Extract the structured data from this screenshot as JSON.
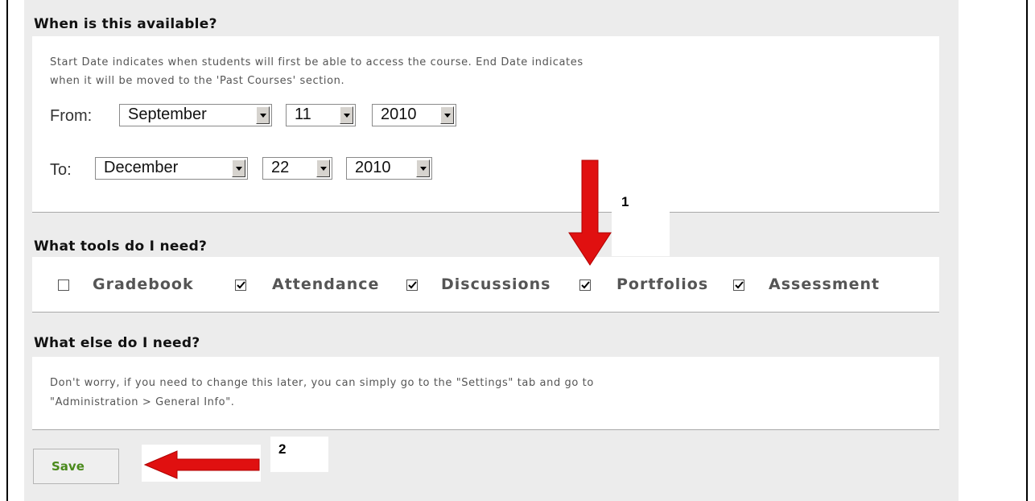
{
  "availability": {
    "heading": "When is this available?",
    "desc_line1": "Start Date indicates when students will first be able to access the course. End Date indicates",
    "desc_line2": "when it will be moved to the 'Past Courses' section.",
    "from_label": "From:",
    "from_month": "September",
    "from_day": "11",
    "from_year": "2010",
    "to_label": "To:",
    "to_month": "December",
    "to_day": "22",
    "to_year": "2010"
  },
  "tools": {
    "heading": "What tools do I need?",
    "items": [
      {
        "label": "Gradebook",
        "checked": false
      },
      {
        "label": "Attendance",
        "checked": true
      },
      {
        "label": "Discussions",
        "checked": true
      },
      {
        "label": "Portfolios",
        "checked": true
      },
      {
        "label": "Assessment",
        "checked": true
      }
    ]
  },
  "else": {
    "heading": "What else do I need?",
    "desc_line1": "Don't worry, if you need to change this later, you can simply go to the \"Settings\" tab and go to",
    "desc_line2": "\"Administration > General Info\"."
  },
  "save_label": "Save",
  "annotations": {
    "marker1": "1",
    "marker2": "2",
    "arrow_color": "#e01010"
  }
}
